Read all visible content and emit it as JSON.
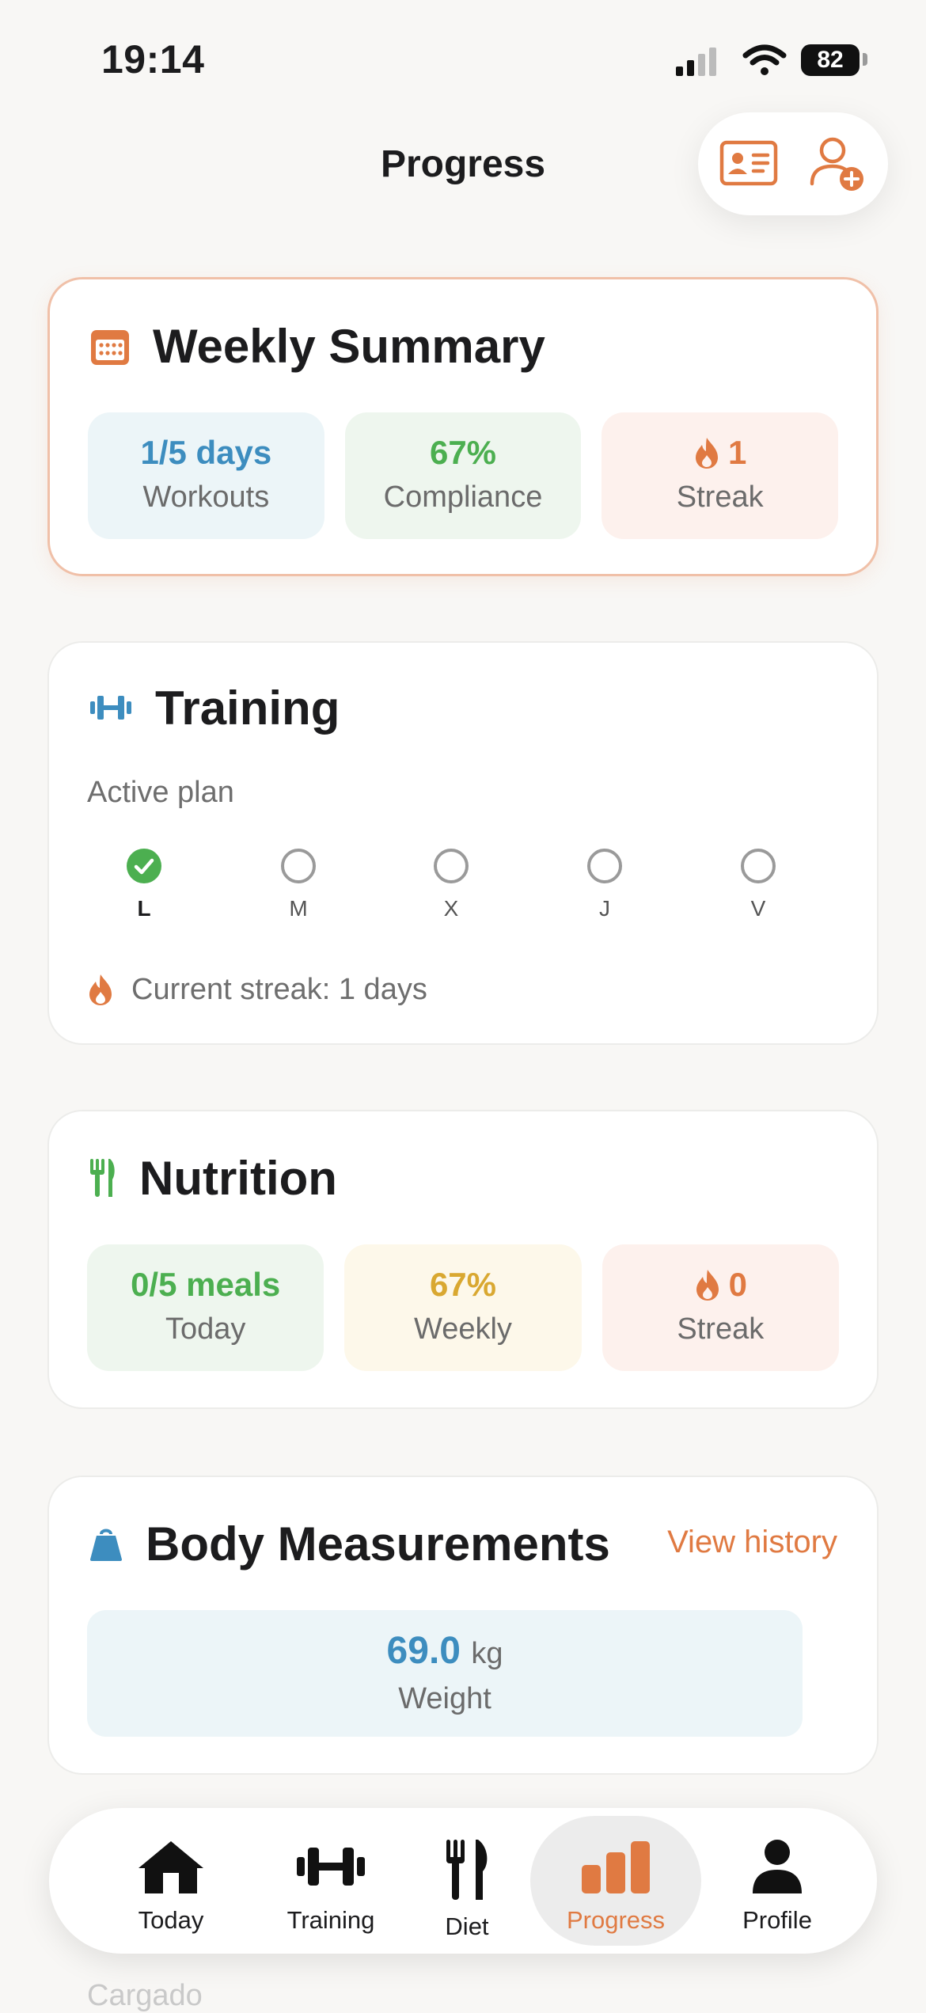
{
  "status_bar": {
    "time": "19:14",
    "battery": "82"
  },
  "header": {
    "title": "Progress"
  },
  "weekly_summary": {
    "title": "Weekly Summary",
    "stats": [
      {
        "value": "1/5 days",
        "label": "Workouts"
      },
      {
        "value": "67%",
        "label": "Compliance"
      },
      {
        "value": "1",
        "label": "Streak"
      }
    ]
  },
  "training": {
    "title": "Training",
    "subtitle": "Active plan",
    "days": [
      {
        "label": "L",
        "completed": true
      },
      {
        "label": "M",
        "completed": false
      },
      {
        "label": "X",
        "completed": false
      },
      {
        "label": "J",
        "completed": false
      },
      {
        "label": "V",
        "completed": false
      }
    ],
    "streak_text": "Current streak: 1 days"
  },
  "nutrition": {
    "title": "Nutrition",
    "stats": [
      {
        "value": "0/5 meals",
        "label": "Today"
      },
      {
        "value": "67%",
        "label": "Weekly"
      },
      {
        "value": "0",
        "label": "Streak"
      }
    ]
  },
  "body_measurements": {
    "title": "Body Measurements",
    "link": "View history",
    "weight": {
      "value": "69.0",
      "unit": "kg",
      "label": "Weight"
    }
  },
  "peek_text": "Cargado",
  "tabbar": {
    "items": [
      {
        "label": "Today"
      },
      {
        "label": "Training"
      },
      {
        "label": "Diet"
      },
      {
        "label": "Progress"
      },
      {
        "label": "Profile"
      }
    ],
    "active_index": 3
  },
  "colors": {
    "accent": "#e07a42",
    "blue": "#3d8dbf",
    "green": "#4caf50",
    "yellow": "#d9a831",
    "background": "#f8f7f5"
  }
}
